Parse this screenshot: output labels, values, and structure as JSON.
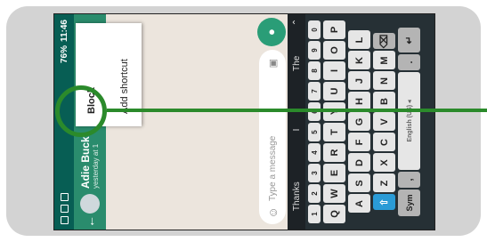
{
  "status": {
    "time": "11:46",
    "battery": "76%"
  },
  "appbar": {
    "back_icon": "arrow-back-icon",
    "contact_name": "Adie Buck",
    "last_seen": "yesterday at 1"
  },
  "menu": {
    "items": [
      "Block",
      "Add shortcut"
    ]
  },
  "compose": {
    "placeholder": "Type a message",
    "emoji_icon": "emoji-icon",
    "camera_icon": "camera-icon",
    "mic_icon": "mic-icon"
  },
  "suggestions": [
    "Thanks",
    "I",
    "The"
  ],
  "keyboard": {
    "numbers": [
      "1",
      "2",
      "3",
      "4",
      "5",
      "6",
      "7",
      "8",
      "9",
      "0"
    ],
    "row1": [
      "Q",
      "W",
      "E",
      "R",
      "T",
      "Y",
      "U",
      "I",
      "O",
      "P"
    ],
    "row2": [
      "A",
      "S",
      "D",
      "F",
      "G",
      "H",
      "J",
      "K",
      "L"
    ],
    "row3": [
      "Z",
      "X",
      "C",
      "V",
      "B",
      "N",
      "M"
    ],
    "sym": "Sym",
    "space_label": "English (US) ◂"
  },
  "colors": {
    "whatsapp_dark": "#075e54",
    "whatsapp_bar": "#2a8c6d",
    "annotation_green": "#2b8a2b",
    "keyboard_bg": "#263035"
  }
}
